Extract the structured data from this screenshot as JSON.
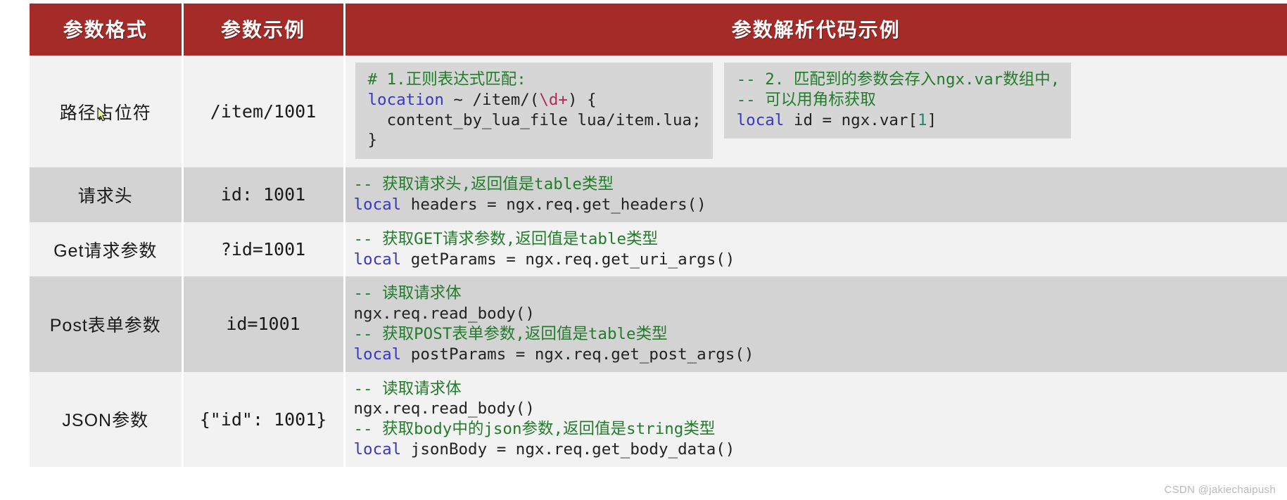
{
  "table": {
    "headers": [
      {
        "label": "参数格式"
      },
      {
        "label": "参数示例"
      },
      {
        "label": "参数解析代码示例"
      }
    ],
    "header_bg": "#a42b28",
    "header_fg": "#ffffff",
    "band_light": "#f2f2f2",
    "band_dark": "#d3d3d3",
    "code_box_bg": "#d6d6d6",
    "rows": [
      {
        "format": "路径占位符",
        "example": "/item/1001",
        "code_blocks": [
          {
            "boxed": true,
            "lines": [
              [
                {
                  "t": "# 1.",
                  "c": "comment"
                },
                {
                  "t": "正则表达式匹配:",
                  "c": "comment"
                }
              ],
              [
                {
                  "t": "location",
                  "c": "keyword"
                },
                {
                  "t": " ~ /item/(",
                  "c": "plain"
                },
                {
                  "t": "\\d+",
                  "c": "regex"
                },
                {
                  "t": ") {",
                  "c": "plain"
                }
              ],
              [
                {
                  "t": "  content_by_lua_file lua/item.lua;",
                  "c": "plain"
                }
              ],
              [
                {
                  "t": "}",
                  "c": "plain"
                }
              ]
            ]
          },
          {
            "boxed": true,
            "lines": [
              [
                {
                  "t": "-- 2. 匹配到的参数会存入ngx.var数组中,",
                  "c": "comment"
                }
              ],
              [
                {
                  "t": "-- 可以用角标获取",
                  "c": "comment"
                }
              ],
              [
                {
                  "t": "local",
                  "c": "keyword"
                },
                {
                  "t": " id = ngx.var[",
                  "c": "plain"
                },
                {
                  "t": "1",
                  "c": "num"
                },
                {
                  "t": "]",
                  "c": "plain"
                }
              ]
            ]
          }
        ]
      },
      {
        "format": "请求头",
        "example": "id: 1001",
        "code_blocks": [
          {
            "boxed": false,
            "lines": [
              [
                {
                  "t": "-- 获取请求头,返回值是table类型",
                  "c": "comment"
                }
              ],
              [
                {
                  "t": "local",
                  "c": "keyword"
                },
                {
                  "t": " headers = ngx.req.get_headers()",
                  "c": "plain"
                }
              ]
            ]
          }
        ]
      },
      {
        "format": "Get请求参数",
        "example": "?id=1001",
        "code_blocks": [
          {
            "boxed": false,
            "lines": [
              [
                {
                  "t": "-- 获取GET请求参数,返回值是table类型",
                  "c": "comment"
                }
              ],
              [
                {
                  "t": "local",
                  "c": "keyword"
                },
                {
                  "t": " getParams = ngx.req.get_uri_args()",
                  "c": "plain"
                }
              ]
            ]
          }
        ]
      },
      {
        "format": "Post表单参数",
        "example": "id=1001",
        "code_blocks": [
          {
            "boxed": false,
            "lines": [
              [
                {
                  "t": "-- 读取请求体",
                  "c": "comment"
                }
              ],
              [
                {
                  "t": "ngx.req.read_body()",
                  "c": "plain"
                }
              ],
              [
                {
                  "t": "-- 获取POST表单参数,返回值是table类型",
                  "c": "comment"
                }
              ],
              [
                {
                  "t": "local",
                  "c": "keyword"
                },
                {
                  "t": " postParams = ngx.req.get_post_args()",
                  "c": "plain"
                }
              ]
            ]
          }
        ]
      },
      {
        "format": "JSON参数",
        "example": "{\"id\": 1001}",
        "code_blocks": [
          {
            "boxed": false,
            "lines": [
              [
                {
                  "t": "-- 读取请求体",
                  "c": "comment"
                }
              ],
              [
                {
                  "t": "ngx.req.read_body()",
                  "c": "plain"
                }
              ],
              [
                {
                  "t": "-- 获取body中的json参数,返回值是string类型",
                  "c": "comment"
                }
              ],
              [
                {
                  "t": "local",
                  "c": "keyword"
                },
                {
                  "t": " jsonBody = ngx.req.get_body_data()",
                  "c": "plain"
                }
              ]
            ]
          }
        ]
      }
    ]
  },
  "cursor": {
    "icon": "mouse-pointer-icon"
  },
  "watermark": {
    "text": "CSDN @jakiechaipush"
  }
}
